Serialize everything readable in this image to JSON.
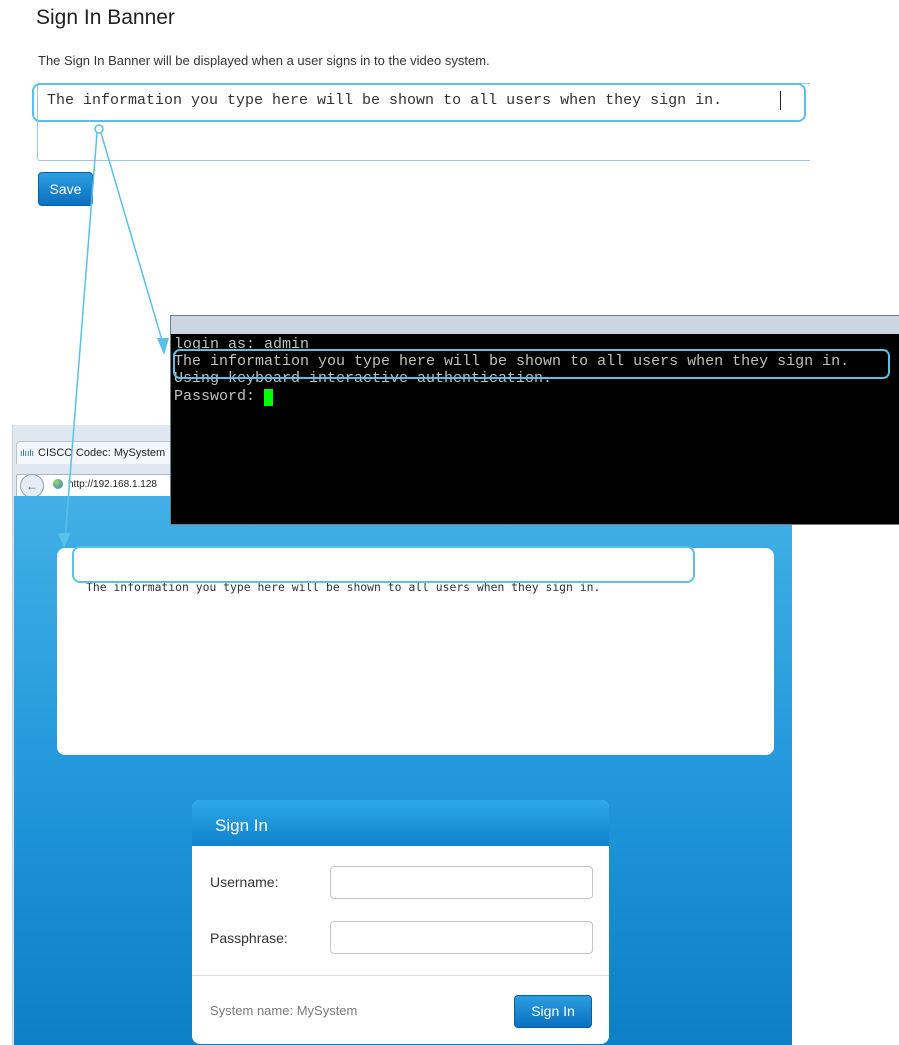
{
  "settings": {
    "title": "Sign In Banner",
    "description": "The Sign In Banner will be displayed when a user signs in to the video system.",
    "banner_text": "The information you type here will be shown to all users when they sign in.",
    "save_label": "Save"
  },
  "terminal": {
    "line1": "login as: admin",
    "line2": "The information you type here will be shown to all users when they sign in.",
    "line3": "Using keyboard-interactive authentication.",
    "line4": "Password: "
  },
  "browser": {
    "tab_title": "CISCO Codec: MySystem",
    "url": "http://192.168.1.128",
    "banner_text": "The information you type here will be shown to all users when they sign in."
  },
  "signin": {
    "title": "Sign In",
    "username_label": "Username:",
    "passphrase_label": "Passphrase:",
    "system_name": "System name: MySystem",
    "signin_button": "Sign In"
  },
  "colors": {
    "accent": "#5bc0e8",
    "button_blue": "#0a6fc1",
    "page_blue": "#1d93d9",
    "terminal_cursor": "#00ff00"
  },
  "icons": {
    "back": "back-arrow-icon",
    "globe": "globe-icon",
    "logo": "cisco-logo-icon"
  }
}
